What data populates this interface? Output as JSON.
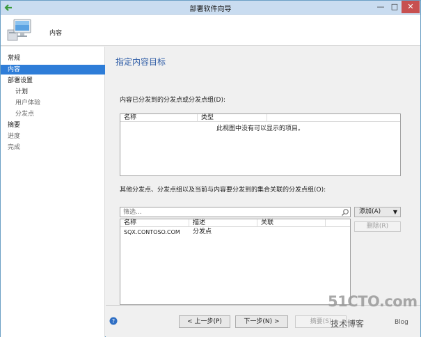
{
  "window": {
    "title": "部署软件向导",
    "controls": {
      "minimize": "—",
      "maximize": "□",
      "close": "✕"
    }
  },
  "header": {
    "title": "内容"
  },
  "sidebar": {
    "items": [
      {
        "label": "常规",
        "active": false
      },
      {
        "label": "内容",
        "active": true
      },
      {
        "label": "部署设置",
        "active": false
      },
      {
        "label": "计划",
        "active": false
      },
      {
        "label": "用户体验",
        "active": false
      },
      {
        "label": "分发点",
        "active": false
      },
      {
        "label": "摘要",
        "active": false
      },
      {
        "label": "进度",
        "active": false
      },
      {
        "label": "完成",
        "active": false
      }
    ]
  },
  "main": {
    "heading": "指定内容目标",
    "distributed_label": "内容已分发到的分发点或分发点组(D):",
    "distributed_list": {
      "columns": [
        "名称",
        "类型"
      ],
      "empty_text": "此视图中没有可以显示的项目。"
    },
    "other_label": "其他分发点、分发点组以及当前与内容要分发到的集合关联的分发点组(O):",
    "filter": {
      "placeholder": "筛选..."
    },
    "other_list": {
      "columns": [
        "名称",
        "描述",
        "关联"
      ],
      "rows": [
        {
          "name": "SQX.CONTOSO.COM",
          "description": "分发点",
          "association": ""
        }
      ]
    },
    "buttons": {
      "add": "添加(A)",
      "add_caret": "▼",
      "remove": "删除(R)"
    }
  },
  "footer": {
    "back": "< 上一步(P)",
    "next": "下一步(N) >",
    "summary": "摘要(S)"
  },
  "watermark": {
    "logo": "51CTO.com",
    "sub": "技术博客",
    "blog": "Blog"
  }
}
